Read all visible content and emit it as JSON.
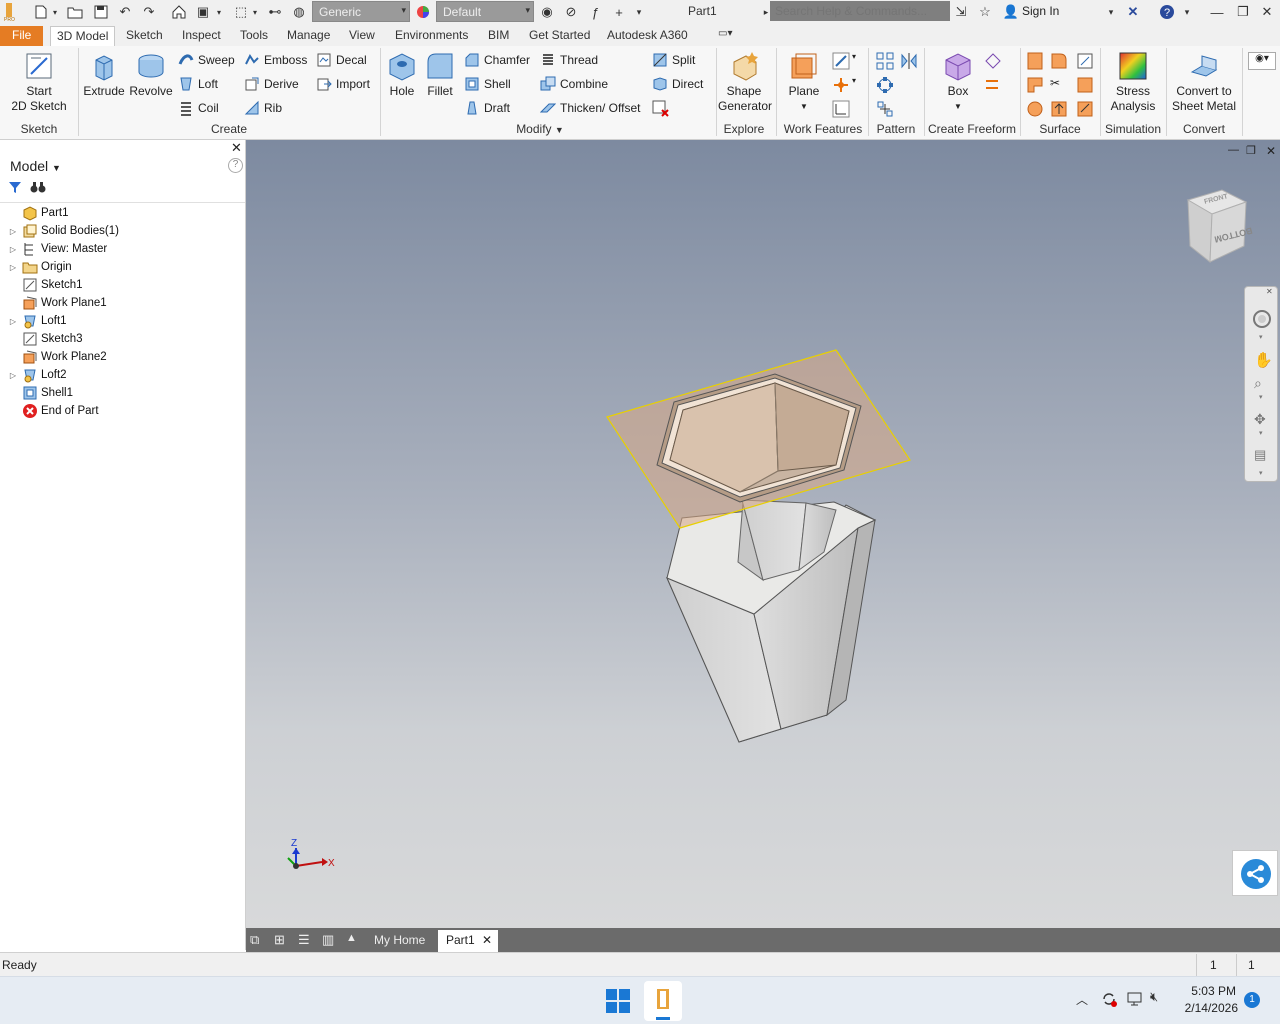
{
  "titlebar": {
    "material_value": "Generic",
    "appearance_value": "Default",
    "document_title": "Part1",
    "search_placeholder": "Search Help & Commands...",
    "sign_in": "Sign In"
  },
  "tabs": [
    "File",
    "3D Model",
    "Sketch",
    "Inspect",
    "Tools",
    "Manage",
    "View",
    "Environments",
    "BIM",
    "Get Started",
    "Autodesk A360"
  ],
  "ribbon": {
    "sketch": {
      "start_line1": "Start",
      "start_line2": "2D Sketch",
      "label": "Sketch"
    },
    "create": {
      "extrude": "Extrude",
      "revolve": "Revolve",
      "sweep": "Sweep",
      "loft": "Loft",
      "coil": "Coil",
      "emboss": "Emboss",
      "derive": "Derive",
      "rib": "Rib",
      "decal": "Decal",
      "import": "Import",
      "label": "Create"
    },
    "modify": {
      "hole": "Hole",
      "fillet": "Fillet",
      "chamfer": "Chamfer",
      "shell": "Shell",
      "draft": "Draft",
      "thread": "Thread",
      "combine": "Combine",
      "thicken": "Thicken/ Offset",
      "split": "Split",
      "direct": "Direct",
      "label": "Modify"
    },
    "explore": {
      "shape_line1": "Shape",
      "shape_line2": "Generator",
      "label": "Explore"
    },
    "work": {
      "plane": "Plane",
      "label": "Work Features"
    },
    "pattern": {
      "label": "Pattern"
    },
    "freeform": {
      "box": "Box",
      "label": "Create Freeform"
    },
    "surface": {
      "label": "Surface"
    },
    "simulation": {
      "stress_line1": "Stress",
      "stress_line2": "Analysis",
      "label": "Simulation"
    },
    "convert": {
      "line1": "Convert to",
      "line2": "Sheet Metal",
      "label": "Convert"
    }
  },
  "panel": {
    "title": "Model",
    "tree": [
      {
        "label": "Part1",
        "expandable": false,
        "icon": "part-icon"
      },
      {
        "label": "Solid Bodies(1)",
        "expandable": true,
        "icon": "solid-bodies-icon"
      },
      {
        "label": "View: Master",
        "expandable": true,
        "icon": "view-icon"
      },
      {
        "label": "Origin",
        "expandable": true,
        "icon": "folder-icon"
      },
      {
        "label": "Sketch1",
        "expandable": false,
        "icon": "sketch-icon"
      },
      {
        "label": "Work Plane1",
        "expandable": false,
        "icon": "work-plane-icon"
      },
      {
        "label": "Loft1",
        "expandable": true,
        "icon": "loft-icon"
      },
      {
        "label": "Sketch3",
        "expandable": false,
        "icon": "sketch-icon"
      },
      {
        "label": "Work Plane2",
        "expandable": false,
        "icon": "work-plane-icon"
      },
      {
        "label": "Loft2",
        "expandable": true,
        "icon": "loft-icon"
      },
      {
        "label": "Shell1",
        "expandable": false,
        "icon": "shell-icon"
      },
      {
        "label": "End of Part",
        "expandable": false,
        "icon": "end-of-part-icon"
      }
    ]
  },
  "viewcube": {
    "top_face": "FRONT",
    "front_face": "BOTTOM"
  },
  "triad": {
    "z": "Z",
    "x": "X"
  },
  "doctabs": {
    "home": "My Home",
    "part": "Part1"
  },
  "status": {
    "text": "Ready",
    "count1": "1",
    "count2": "1"
  },
  "taskbar": {
    "time": "5:03 PM",
    "date": "2/14/2026",
    "badge": "1"
  },
  "colors": {
    "accent_file": "#e57c23",
    "viewport_top": "#7d8aa0",
    "viewport_bottom": "#d8d9da",
    "plane_edge": "#e8d000"
  }
}
